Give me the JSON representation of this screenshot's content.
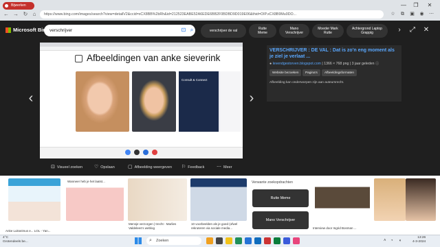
{
  "browser": {
    "tab_label": "Bijwerken",
    "url": "https://www.bing.com/images/search?view=detailV2&ccid=xCX8BB%2bRh&id=212523EABE52A6EDE6BB2F0BDBD9D019E06&thid=OIP.xCX8B9Mu0DO...",
    "window_controls": [
      "—",
      "❐",
      "✕"
    ]
  },
  "bing": {
    "logo_text": "Microsoft Bing",
    "search_value": "verschrijver",
    "related_pills": [
      {
        "l1": "verschrijver de val",
        "l2": ""
      },
      {
        "l1": "Rutte",
        "l2": "Meme"
      },
      {
        "l1": "Mano",
        "l2": "Verschrijver"
      },
      {
        "l1": "Moeder Mark",
        "l2": "Rutte"
      },
      {
        "l1": "Achtergrond Laptop",
        "l2": "Grappig"
      }
    ]
  },
  "preview": {
    "page_title": "Afbeeldingen van anke sieverink",
    "mag_text": "Consult & Connect"
  },
  "details": {
    "title": "VERSCHRIJVER : DE VAL : Dat is zo'n eng moment als je ziel je verlaat ...",
    "source": "levendgestorven.blogspot.com",
    "meta": "| 1366 × 768 png | 3 jaar geleden",
    "buttons": [
      "Website bezoeken",
      "Pagina's",
      "Afbeeldingsformaten"
    ],
    "note": "Afbeelding kan onderworpen zijn aan auteursrecht."
  },
  "toolbar": {
    "visual_search": "Visueel zoeken",
    "save": "Opslaan",
    "show_image": "Afbeelding weergeven",
    "feedback": "Feedback",
    "more": "Meer"
  },
  "strip": {
    "cap_a": "Anke Lukseimus e... LOL - Yan...",
    "cap_b": "Wanneer heb je het laatst...",
    "cap_c": "Mensje verzorgen | trecht - Marlies Valdelees's weblog",
    "cap_d": "10 voorbeelden als je goed (ofwel rekruteren via sociale media...",
    "suggestions_header": "Verwante zoekopdrachten",
    "suggestions": [
      "Rutte Meme",
      "Mano Verschrijver"
    ],
    "cap_e": "Interview door Ingrid Bosman ..."
  },
  "taskbar": {
    "weather_temp": "4°C",
    "weather_desc": "Grotendeels be...",
    "search_placeholder": "Zoeken",
    "time": "13:26",
    "date": "4-3-2024"
  }
}
